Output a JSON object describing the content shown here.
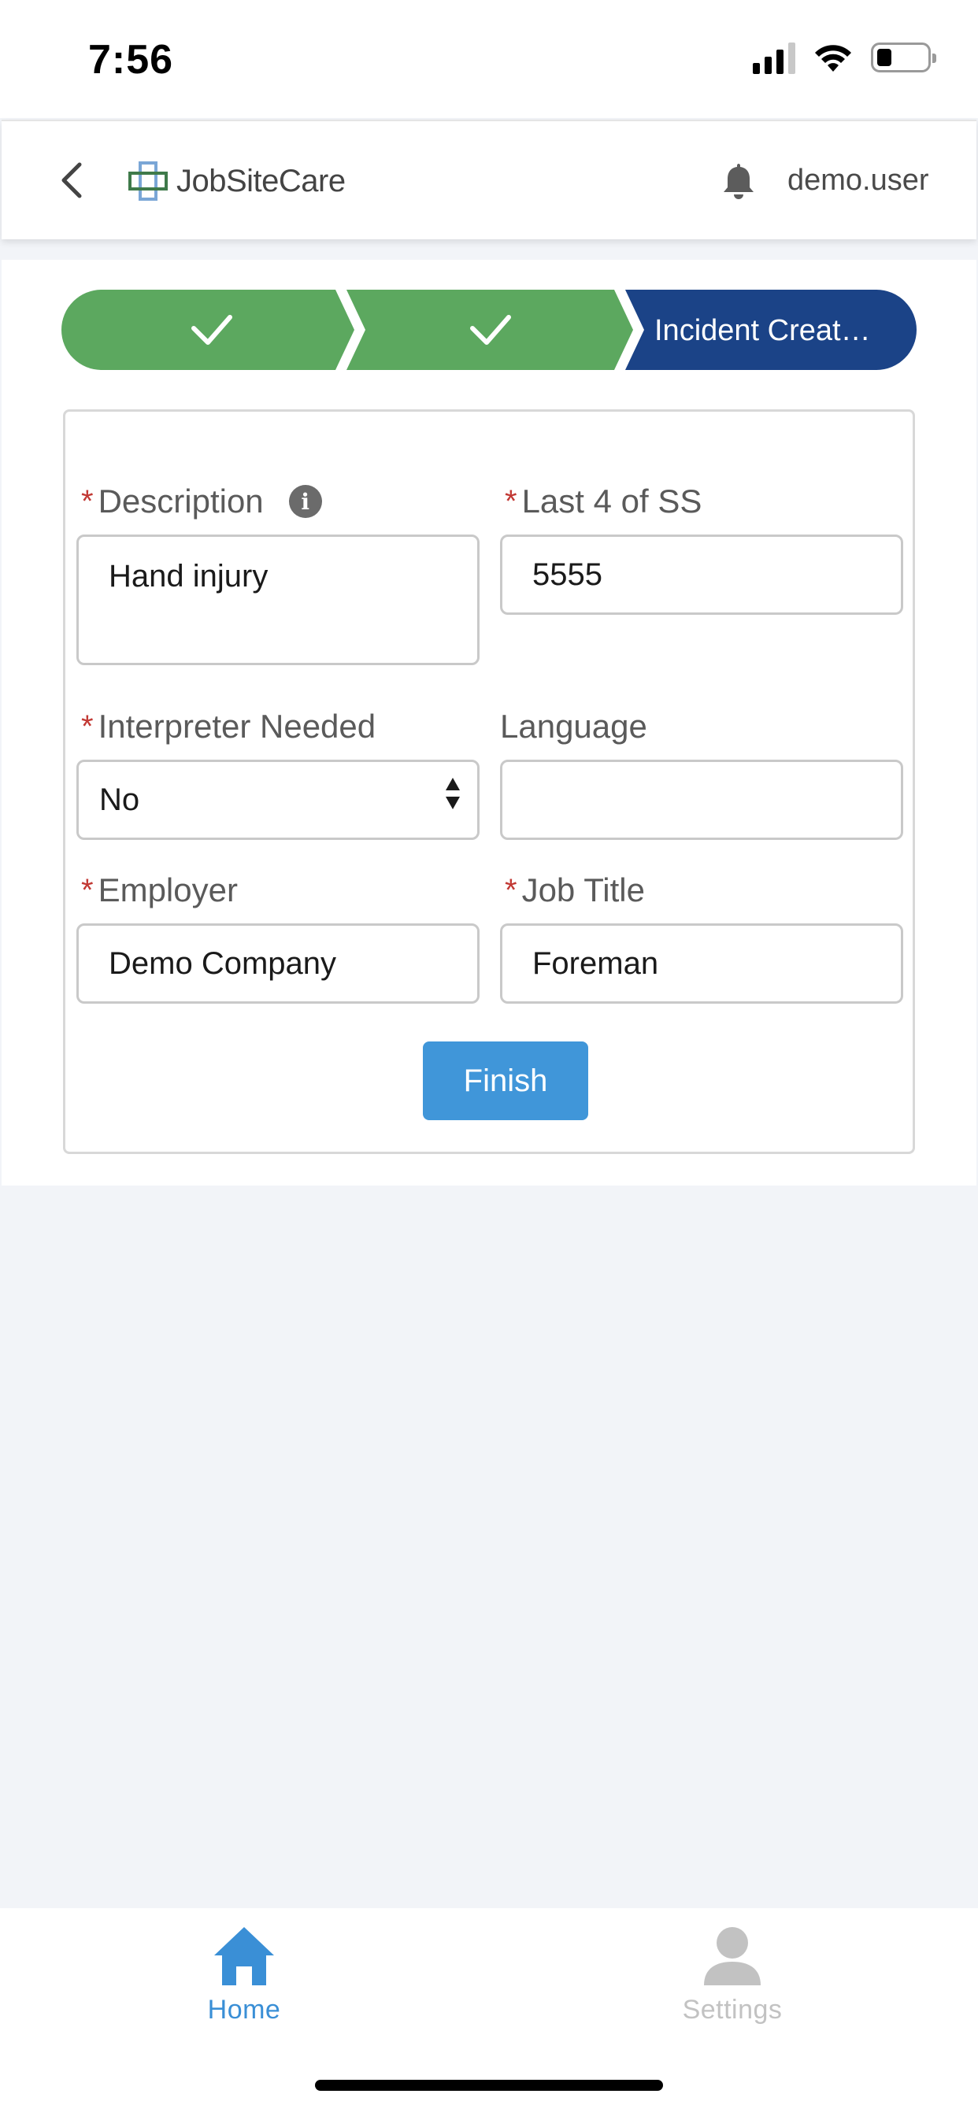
{
  "status_bar": {
    "time": "7:56",
    "icons": [
      "cellular-signal-icon",
      "wifi-icon",
      "battery-icon"
    ]
  },
  "header": {
    "logo_text": "JobSiteCare",
    "username": "demo.user",
    "icons": [
      "back-chevron-icon",
      "logo-cross-icon",
      "bell-icon"
    ]
  },
  "stepper": {
    "steps": [
      {
        "state": "complete",
        "icon": "checkmark-icon"
      },
      {
        "state": "complete",
        "icon": "checkmark-icon"
      },
      {
        "state": "current",
        "label": "Incident Creat…"
      }
    ],
    "colors": {
      "complete": "#5ca85f",
      "current": "#1b4387"
    }
  },
  "form": {
    "description": {
      "label": "Description",
      "required": true,
      "value": "Hand injury"
    },
    "last4ss": {
      "label": "Last 4 of SS",
      "required": true,
      "value": "5555"
    },
    "interpreter": {
      "label": "Interpreter Needed",
      "required": true,
      "value": "No"
    },
    "language": {
      "label": "Language",
      "required": false,
      "value": ""
    },
    "employer": {
      "label": "Employer",
      "required": true,
      "value": "Demo Company"
    },
    "job_title": {
      "label": "Job Title",
      "required": true,
      "value": "Foreman"
    },
    "required_marker": "*",
    "finish_label": "Finish"
  },
  "tabbar": {
    "tabs": [
      {
        "label": "Home",
        "icon": "home-icon",
        "active": true
      },
      {
        "label": "Settings",
        "icon": "person-icon",
        "active": false
      }
    ],
    "colors": {
      "active": "#3a8fd6",
      "inactive": "#c2c2c2"
    }
  }
}
